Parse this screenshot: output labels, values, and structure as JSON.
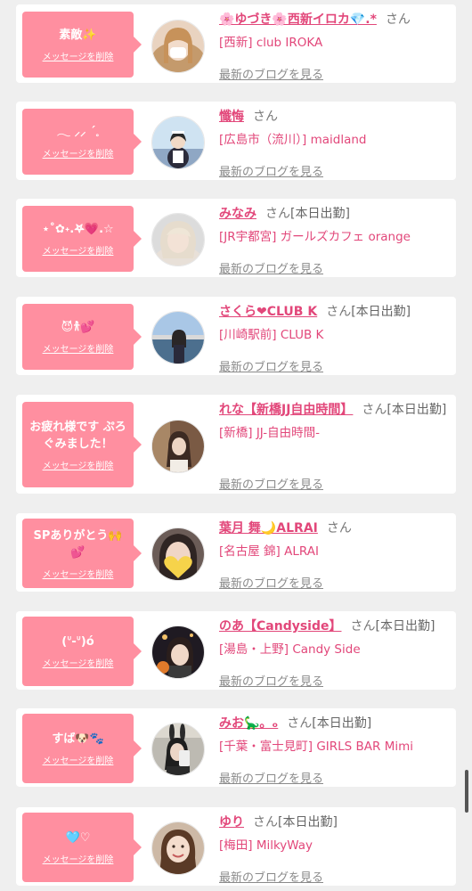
{
  "accent_pink": "#ff8fa0",
  "name_color": "#e2477a",
  "cards": [
    {
      "message": "素敵✨",
      "delete_label": "メッセージを削除",
      "name": "🌸ゆづき🌸西新イロカ💎.*",
      "honorific": "さん",
      "status": "",
      "shop": "[西新] club IROKA",
      "blog_link": "最新のブログを見る",
      "avatar": "portrait-woman-mask"
    },
    {
      "message": "𓂃 ⸝⸝ ˊ𓈒",
      "delete_label": "メッセージを削除",
      "name": "懺悔",
      "honorific": "さん",
      "status": "",
      "shop": "[広島市（流川）] maidland",
      "blog_link": "最新のブログを見る",
      "avatar": "portrait-maid"
    },
    {
      "message": "⋆˚✿˖.𖤐💗.☆",
      "delete_label": "メッセージを削除",
      "name": "みなみ",
      "honorific": "さん",
      "status": "[本日出勤]",
      "shop": "[JR宇都宮] ガールズカフェ orange",
      "blog_link": "最新のブログを見る",
      "avatar": "portrait-blonde"
    },
    {
      "message": "😈𐀪💕",
      "delete_label": "メッセージを削除",
      "name": "さくら❤CLUB K",
      "honorific": "さん",
      "status": "[本日出勤]",
      "shop": "[川崎駅前] CLUB K",
      "blog_link": "最新のブログを見る",
      "avatar": "portrait-outdoor"
    },
    {
      "message": "お疲れ様です ぷろぐみました！",
      "delete_label": "メッセージを削除",
      "name": "れな【新橋JJ自由時間】",
      "honorific": "さん",
      "status": "[本日出勤]",
      "shop": "[新橋] JJ-自由時間-",
      "blog_link": "最新のブログを見る",
      "avatar": "portrait-indoor"
    },
    {
      "message": "SPありがとう🙌💕",
      "delete_label": "メッセージを削除",
      "name": "葉月 舞🌙ALRAI",
      "honorific": "さん",
      "status": "",
      "shop": "[名古屋 錦] ALRAI",
      "blog_link": "最新のブログを見る",
      "avatar": "portrait-heart"
    },
    {
      "message": "(ᐡ-ᐡ)ó",
      "delete_label": "メッセージを削除",
      "name": "のあ【Candyside】",
      "honorific": "さん",
      "status": "[本日出勤]",
      "shop": "[湯島・上野] Candy Side",
      "blog_link": "最新のブログを見る",
      "avatar": "portrait-halloween"
    },
    {
      "message": "すば🐶🐾",
      "delete_label": "メッセージを削除",
      "name": "みお🦕。ₒ",
      "honorific": "さん",
      "status": "[本日出勤]",
      "shop": "[千葉・富士見町] GIRLS BAR Mimi",
      "blog_link": "最新のブログを見る",
      "avatar": "portrait-bunny"
    },
    {
      "message": "🩵♡",
      "delete_label": "メッセージを削除",
      "name": "ゆり",
      "honorific": "さん",
      "status": "[本日出勤]",
      "shop": "[梅田] MilkyWay",
      "blog_link": "最新のブログを見る",
      "avatar": "portrait-smile"
    }
  ]
}
